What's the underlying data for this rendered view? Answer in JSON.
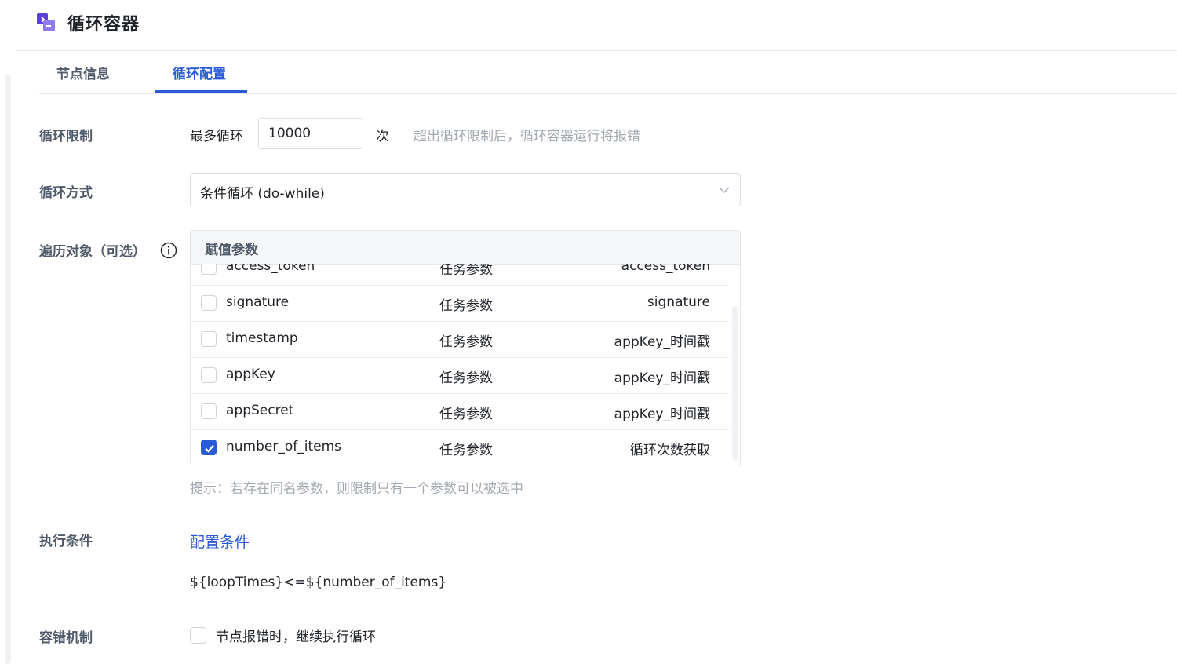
{
  "header": {
    "title": "循环容器",
    "icon": "loop-container-icon",
    "accent": "#5b3fd6"
  },
  "tabs": [
    {
      "label": "节点信息",
      "active": false
    },
    {
      "label": "循环配置",
      "active": true
    }
  ],
  "loop_limit": {
    "label": "循环限制",
    "prefix": "最多循环",
    "value": "10000",
    "unit": "次",
    "hint": "超出循环限制后，循环容器运行将报错"
  },
  "loop_mode": {
    "label": "循环方式",
    "selected": "条件循环 (do-while)"
  },
  "iterate": {
    "label": "遍历对象（可选）",
    "column_header": "赋值参数",
    "rows": [
      {
        "name": "access_token",
        "type": "任务参数",
        "desc": "access_token",
        "checked": false
      },
      {
        "name": "signature",
        "type": "任务参数",
        "desc": "signature",
        "checked": false
      },
      {
        "name": "timestamp",
        "type": "任务参数",
        "desc": "appKey_时间戳",
        "checked": false
      },
      {
        "name": "appKey",
        "type": "任务参数",
        "desc": "appKey_时间戳",
        "checked": false
      },
      {
        "name": "appSecret",
        "type": "任务参数",
        "desc": "appKey_时间戳",
        "checked": false
      },
      {
        "name": "number_of_items",
        "type": "任务参数",
        "desc": "循环次数获取",
        "checked": true
      }
    ],
    "hint": "提示：若存在同名参数，则限制只有一个参数可以被选中"
  },
  "condition": {
    "label": "执行条件",
    "link": "配置条件",
    "expression": "${loopTimes}<=${number_of_items}"
  },
  "fault": {
    "label": "容错机制",
    "option": "节点报错时，继续执行循环",
    "checked": false
  },
  "colors": {
    "primary": "#2a5bd7",
    "label": "#4e5969",
    "muted": "#a3a9b3"
  }
}
